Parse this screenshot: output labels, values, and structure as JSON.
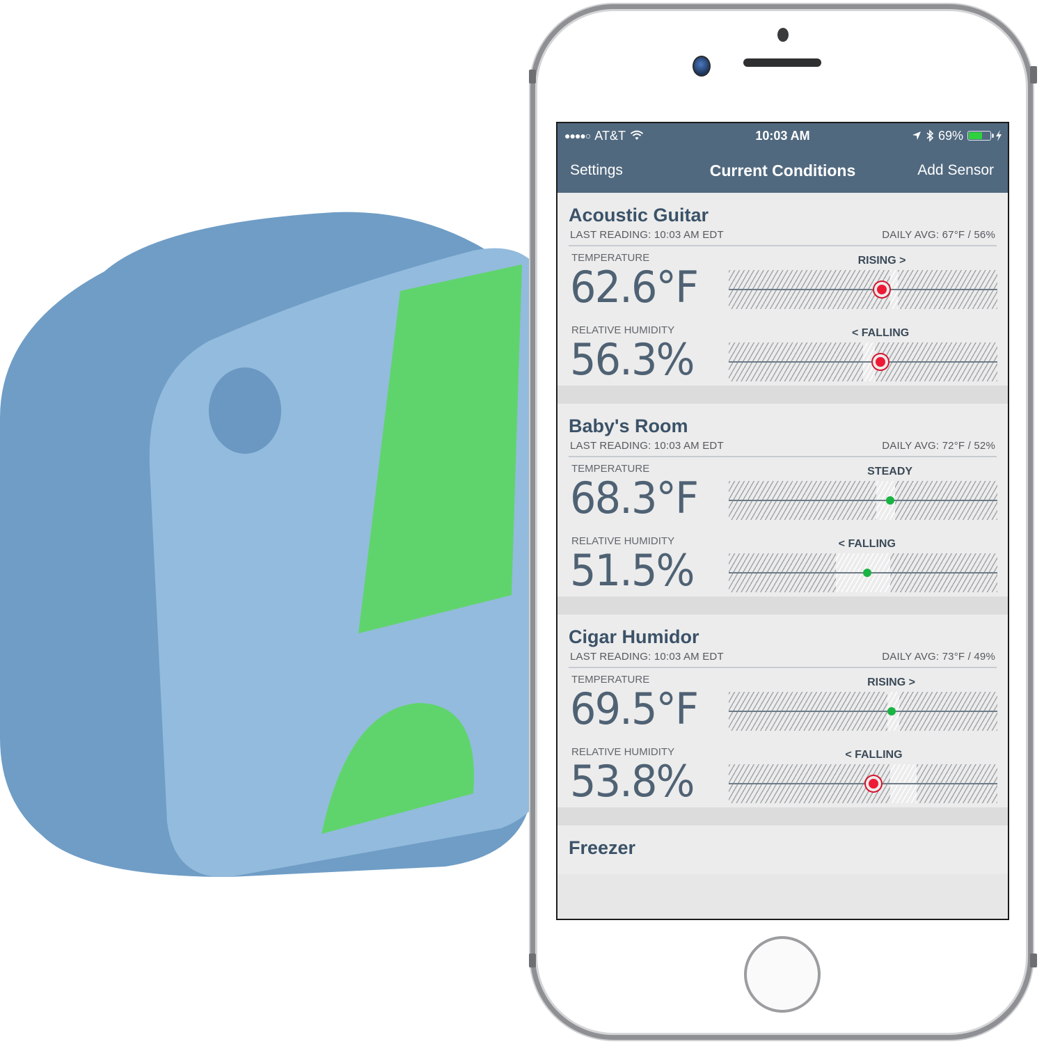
{
  "status_bar": {
    "signal": "●●●●○",
    "carrier": "AT&T",
    "time": "10:03 AM",
    "battery_percent": "69%",
    "battery_level": 0.69,
    "icons": [
      "wifi-icon",
      "location-arrow-icon",
      "bluetooth-icon",
      "battery-icon",
      "charging-bolt-icon"
    ]
  },
  "nav": {
    "left_label": "Settings",
    "title": "Current Conditions",
    "right_label": "Add Sensor"
  },
  "colors": {
    "nav_bg": "#51697f",
    "ok_marker": "#19b443",
    "alert_marker": "#ee1a35",
    "sensor_body": "#8eb6d9",
    "sensor_accent": "#5fd46c"
  },
  "sensors": [
    {
      "name": "Acoustic Guitar",
      "last_reading": "LAST READING: 10:03 AM EDT",
      "daily_avg": "DAILY AVG: 67°F / 56%",
      "temperature": {
        "label": "TEMPERATURE",
        "value": "62.6°F",
        "trend": "RISING >",
        "status": "alert",
        "position": 0.57,
        "range": [
          0.6,
          0.63
        ]
      },
      "humidity": {
        "label": "RELATIVE HUMIDITY",
        "value": "56.3%",
        "trend": "< FALLING",
        "status": "alert",
        "position": 0.565,
        "range": [
          0.5,
          0.545
        ]
      }
    },
    {
      "name": "Baby's Room",
      "last_reading": "LAST READING: 10:03 AM EDT",
      "daily_avg": "DAILY AVG: 72°F / 52%",
      "temperature": {
        "label": "TEMPERATURE",
        "value": "68.3°F",
        "trend": "STEADY",
        "status": "ok",
        "position": 0.6,
        "range": [
          0.55,
          0.62
        ]
      },
      "humidity": {
        "label": "RELATIVE HUMIDITY",
        "value": "51.5%",
        "trend": "< FALLING",
        "status": "ok",
        "position": 0.515,
        "range": [
          0.4,
          0.6
        ]
      }
    },
    {
      "name": "Cigar Humidor",
      "last_reading": "LAST READING: 10:03 AM EDT",
      "daily_avg": "DAILY AVG: 73°F / 49%",
      "temperature": {
        "label": "TEMPERATURE",
        "value": "69.5°F",
        "trend": "RISING >",
        "status": "ok",
        "position": 0.605,
        "range": [
          0.59,
          0.635
        ]
      },
      "humidity": {
        "label": "RELATIVE HUMIDITY",
        "value": "53.8%",
        "trend": "< FALLING",
        "status": "alert",
        "position": 0.54,
        "range": [
          0.6,
          0.7
        ]
      }
    },
    {
      "name": "Freezer"
    }
  ]
}
